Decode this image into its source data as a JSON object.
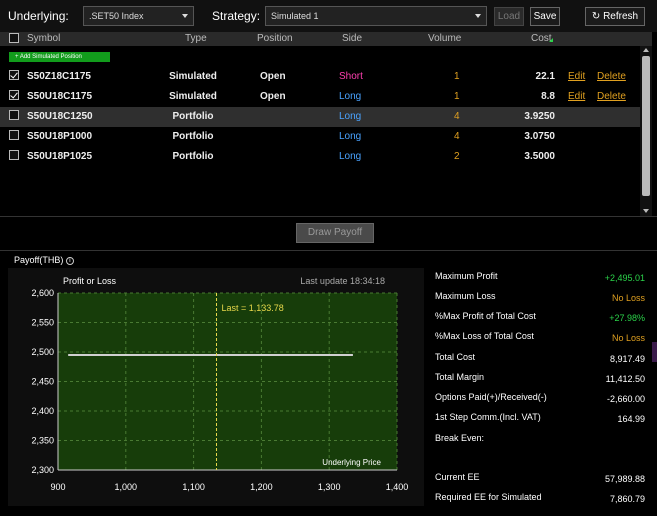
{
  "toolbar": {
    "underlying_label": "Underlying:",
    "underlying_value": ".SET50 Index",
    "strategy_label": "Strategy:",
    "strategy_value": "Simulated 1",
    "load_label": "Load",
    "save_label": "Save",
    "refresh_label": "Refresh"
  },
  "table": {
    "headers": [
      "Symbol",
      "Type",
      "Position",
      "Side",
      "Volume",
      "Cost"
    ],
    "add_label": "+ Add Simulated Position",
    "rows": [
      {
        "symbol": "S50Z18C1175",
        "type": "Simulated",
        "position": "Open",
        "side": "Short",
        "volume": "1",
        "cost": "22.1",
        "edit": "Edit",
        "delete": "Delete",
        "checked": true
      },
      {
        "symbol": "S50U18C1175",
        "type": "Simulated",
        "position": "Open",
        "side": "Long",
        "volume": "1",
        "cost": "8.8",
        "edit": "Edit",
        "delete": "Delete",
        "checked": true
      },
      {
        "symbol": "S50U18C1250",
        "type": "Portfolio",
        "position": "",
        "side": "Long",
        "volume": "4",
        "cost": "3.9250",
        "checked": false
      },
      {
        "symbol": "S50U18P1000",
        "type": "Portfolio",
        "position": "",
        "side": "Long",
        "volume": "4",
        "cost": "3.0750",
        "checked": false
      },
      {
        "symbol": "S50U18P1025",
        "type": "Portfolio",
        "position": "",
        "side": "Long",
        "volume": "2",
        "cost": "3.5000",
        "checked": false
      }
    ]
  },
  "draw_payoff_label": "Draw Payoff",
  "payoff": {
    "title": "Payoff(THB)",
    "info_icon": "info-icon"
  },
  "chart_data": {
    "type": "line",
    "title": "Profit or Loss",
    "last_update": "Last update 18:34:18",
    "xlabel": "Underlying Price",
    "ylabel": "",
    "xlim": [
      900,
      1400
    ],
    "ylim": [
      2300,
      2600
    ],
    "xticks": [
      "900",
      "1,000",
      "1,100",
      "1,200",
      "1,300",
      "1,400"
    ],
    "yticks": [
      "2,600",
      "2,550",
      "2,500",
      "2,450",
      "2,400",
      "2,350",
      "2,300"
    ],
    "series": [
      {
        "x": [
          915,
          1335
        ],
        "values": [
          2495,
          2495
        ]
      }
    ],
    "marker": {
      "x": 1133.78,
      "label": "Last = 1,133.78"
    },
    "colors": {
      "bg": "#173d0a",
      "line": "#d0d0d0",
      "marker": "#e8d84a"
    }
  },
  "stats": [
    {
      "key": "Maximum Profit",
      "value": "+2,495.01",
      "color": "green"
    },
    {
      "key": "Maximum Loss",
      "value": "No Loss",
      "color": "orange"
    },
    {
      "key": "%Max Profit of Total Cost",
      "value": "+27.98%",
      "color": "green"
    },
    {
      "key": "%Max Loss of Total Cost",
      "value": "No Loss",
      "color": "orange"
    },
    {
      "key": "Total Cost",
      "value": "8,917.49",
      "color": "white"
    },
    {
      "key": "Total Margin",
      "value": "11,412.50",
      "color": "white"
    },
    {
      "key": "Options Paid(+)/Received(-)",
      "value": "-2,660.00",
      "color": "white"
    },
    {
      "key": "1st Step Comm.(Incl. VAT)",
      "value": "164.99",
      "color": "white"
    },
    {
      "key": "Break Even:",
      "value": "",
      "color": "white"
    },
    {
      "key": "",
      "value": "",
      "color": "white"
    },
    {
      "key": "Current EE",
      "value": "57,989.88",
      "color": "white"
    },
    {
      "key": "Required EE for Simulated",
      "value": "7,860.79",
      "color": "white"
    }
  ]
}
